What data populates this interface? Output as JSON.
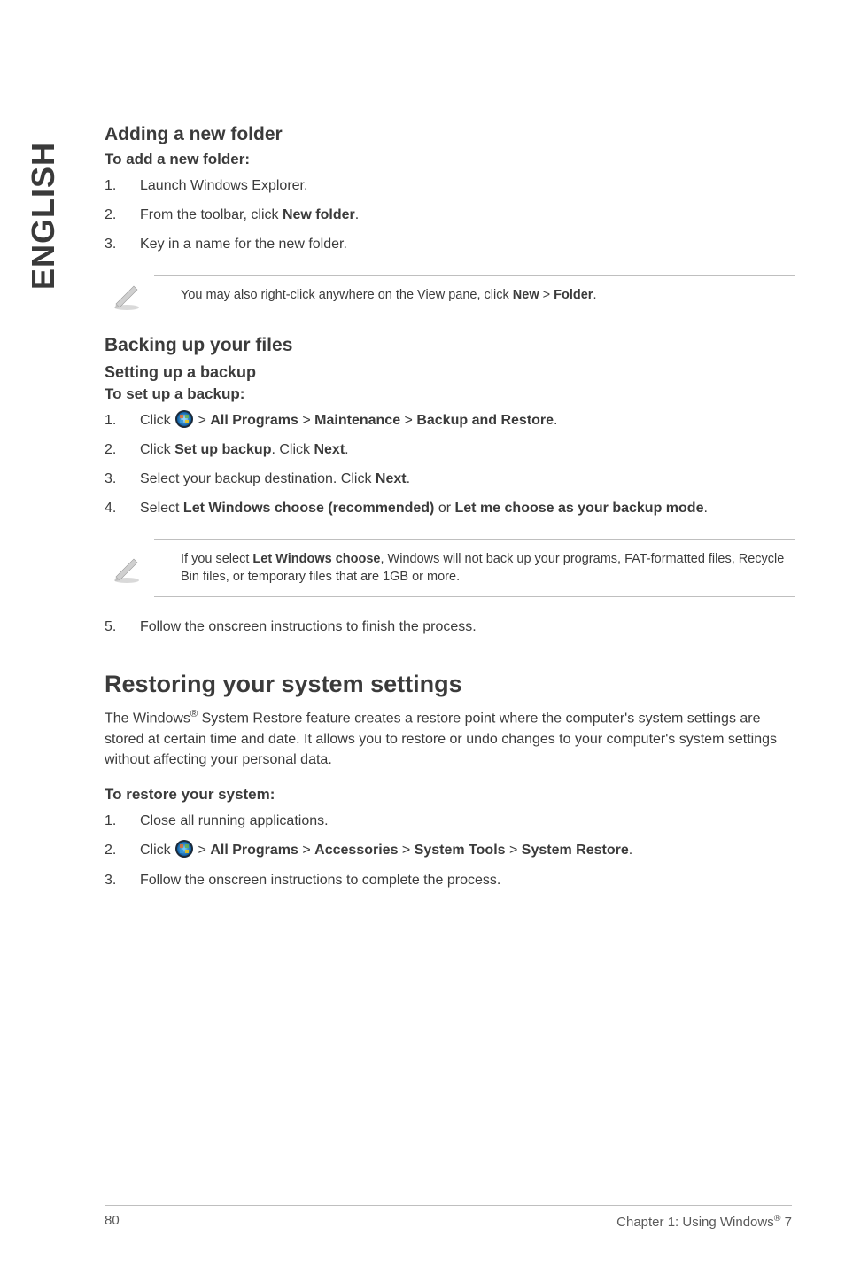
{
  "sidebar": {
    "lang": "ENGLISH"
  },
  "section_add_folder": {
    "heading": "Adding a new folder",
    "sub": "To add a new folder:",
    "steps": [
      {
        "n": "1.",
        "text": "Launch Windows Explorer."
      },
      {
        "n": "2.",
        "pre": "From the toolbar, click ",
        "bold": "New folder",
        "post": "."
      },
      {
        "n": "3.",
        "text": "Key in a name for the new folder."
      }
    ],
    "note_pre": "You may also right-click anywhere on the View pane, click ",
    "note_b1": "New",
    "note_mid": " > ",
    "note_b2": "Folder",
    "note_post": "."
  },
  "section_backup": {
    "heading": "Backing up your files",
    "sub": "Setting up a backup",
    "subb": "To set up a backup:",
    "step1": {
      "n": "1.",
      "pre": "Click ",
      "post_a": " > ",
      "b1": "All Programs",
      "post_b": " > ",
      "b2": "Maintenance",
      "post_c": " > ",
      "b3": "Backup and Restore",
      "end": "."
    },
    "step2": {
      "n": "2.",
      "pre": "Click ",
      "b1": "Set up backup",
      "mid": ". Click ",
      "b2": "Next",
      "end": "."
    },
    "step3": {
      "n": "3.",
      "pre": "Select your backup destination. Click ",
      "b1": "Next",
      "end": "."
    },
    "step4": {
      "n": "4.",
      "pre": "Select ",
      "b1": "Let Windows choose (recommended)",
      "mid": " or ",
      "b2": "Let me choose as your backup mode",
      "end": "."
    },
    "note_pre": "If you select ",
    "note_b": "Let Windows choose",
    "note_post": ", Windows will not back up your programs, FAT-formatted files, Recycle Bin files, or temporary files that are 1GB or more.",
    "step5": {
      "n": "5.",
      "text": "Follow the onscreen instructions to finish the process."
    }
  },
  "section_restore": {
    "heading": "Restoring your system settings",
    "para_a": "The Windows",
    "para_sup": "®",
    "para_b": " System Restore feature creates a restore point where the computer's system settings are stored at certain time and date. It allows you to restore or undo changes to your computer's system settings without affecting your personal data.",
    "sub": "To restore your system:",
    "step1": {
      "n": "1.",
      "text": "Close all running applications."
    },
    "step2": {
      "n": "2.",
      "pre": "Click ",
      "post_a": " > ",
      "b1": "All Programs",
      "post_b": " > ",
      "b2": "Accessories",
      "post_c": " > ",
      "b3": "System Tools",
      "post_d": " > ",
      "b4": "System Restore",
      "end": "."
    },
    "step3": {
      "n": "3.",
      "text": "Follow the onscreen instructions to complete the process."
    }
  },
  "footer": {
    "page": "80",
    "chapter_a": "Chapter 1: Using Windows",
    "chapter_sup": "®",
    "chapter_b": " 7"
  }
}
